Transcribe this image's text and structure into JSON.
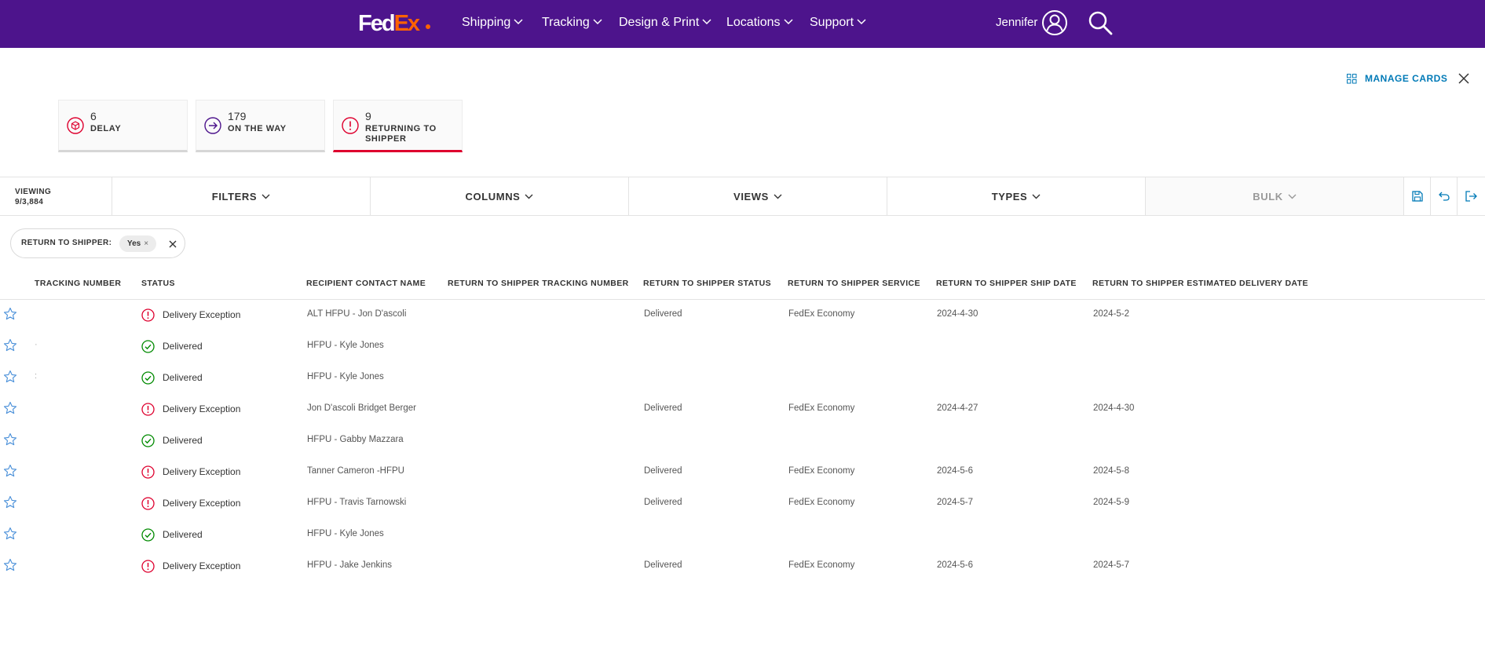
{
  "nav": {
    "logo": {
      "fed": "Fed",
      "ex": "Ex"
    },
    "items": [
      {
        "label": "Shipping"
      },
      {
        "label": "Tracking"
      },
      {
        "label": "Design & Print"
      },
      {
        "label": "Locations"
      },
      {
        "label": "Support"
      }
    ],
    "user_name": "Jennifer"
  },
  "manage_cards": {
    "label": "MANAGE CARDS"
  },
  "cards": [
    {
      "count": "6",
      "label": "DELAY",
      "icon": "box-icon",
      "color": "#de002e"
    },
    {
      "count": "179",
      "label": "ON THE WAY",
      "icon": "arrow-right-circle-icon",
      "color": "#4d148c"
    },
    {
      "count": "9",
      "label": "RETURNING TO SHIPPER",
      "icon": "alert-circle-icon",
      "color": "#de002e"
    }
  ],
  "toolbar": {
    "viewing_label": "VIEWING",
    "viewing_count": "9/3,884",
    "filters": "FILTERS",
    "columns": "COLUMNS",
    "views": "VIEWS",
    "types": "TYPES",
    "bulk": "BULK"
  },
  "filter_chip": {
    "label": "RETURN TO SHIPPER:",
    "value": "Yes",
    "remove": "×"
  },
  "table": {
    "headers": [
      "TRACKING NUMBER",
      "STATUS",
      "RECIPIENT CONTACT NAME",
      "RETURN TO SHIPPER TRACKING NUMBER",
      "RETURN TO SHIPPER STATUS",
      "RETURN TO SHIPPER SERVICE",
      "RETURN TO SHIPPER SHIP DATE",
      "RETURN TO SHIPPER ESTIMATED DELIVERY DATE"
    ],
    "rows": [
      {
        "tracking": "",
        "status": "Delivery Exception",
        "status_type": "exception",
        "recipient": "ALT HFPU - Jon D'ascoli",
        "rts_tracking": "",
        "rts_status": "Delivered",
        "rts_service": "FedEx Economy",
        "rts_ship_date": "2024-4-30",
        "rts_est_date": "2024-5-2"
      },
      {
        "tracking": "·",
        "status": "Delivered",
        "status_type": "delivered",
        "recipient": "HFPU - Kyle Jones",
        "rts_tracking": "",
        "rts_status": "",
        "rts_service": "",
        "rts_ship_date": "",
        "rts_est_date": ""
      },
      {
        "tracking": ":",
        "status": "Delivered",
        "status_type": "delivered",
        "recipient": "HFPU - Kyle Jones",
        "rts_tracking": "",
        "rts_status": "",
        "rts_service": "",
        "rts_ship_date": "",
        "rts_est_date": ""
      },
      {
        "tracking": "",
        "status": "Delivery Exception",
        "status_type": "exception",
        "recipient": "Jon D'ascoli Bridget Berger",
        "rts_tracking": "",
        "rts_status": "Delivered",
        "rts_service": "FedEx Economy",
        "rts_ship_date": "2024-4-27",
        "rts_est_date": "2024-4-30"
      },
      {
        "tracking": "",
        "status": "Delivered",
        "status_type": "delivered",
        "recipient": "HFPU - Gabby Mazzara",
        "rts_tracking": "",
        "rts_status": "",
        "rts_service": "",
        "rts_ship_date": "",
        "rts_est_date": ""
      },
      {
        "tracking": "",
        "status": "Delivery Exception",
        "status_type": "exception",
        "recipient": "Tanner Cameron -HFPU",
        "rts_tracking": "",
        "rts_status": "Delivered",
        "rts_service": "FedEx Economy",
        "rts_ship_date": "2024-5-6",
        "rts_est_date": "2024-5-8"
      },
      {
        "tracking": "",
        "status": "Delivery Exception",
        "status_type": "exception",
        "recipient": "HFPU - Travis Tarnowski",
        "rts_tracking": "",
        "rts_status": "Delivered",
        "rts_service": "FedEx Economy",
        "rts_ship_date": "2024-5-7",
        "rts_est_date": "2024-5-9"
      },
      {
        "tracking": "",
        "status": "Delivered",
        "status_type": "delivered",
        "recipient": "HFPU - Kyle Jones",
        "rts_tracking": "",
        "rts_status": "",
        "rts_service": "",
        "rts_ship_date": "",
        "rts_est_date": ""
      },
      {
        "tracking": "",
        "status": "Delivery Exception",
        "status_type": "exception",
        "recipient": "HFPU - Jake Jenkins",
        "rts_tracking": "",
        "rts_status": "Delivered",
        "rts_service": "FedEx Economy",
        "rts_ship_date": "2024-5-6",
        "rts_est_date": "2024-5-7"
      }
    ]
  },
  "colors": {
    "brand_purple": "#4d148c",
    "brand_orange": "#ff6200",
    "link_blue": "#007ab7",
    "exception_red": "#de002e",
    "delivered_green": "#008a00",
    "star_blue": "#4a90d9"
  }
}
